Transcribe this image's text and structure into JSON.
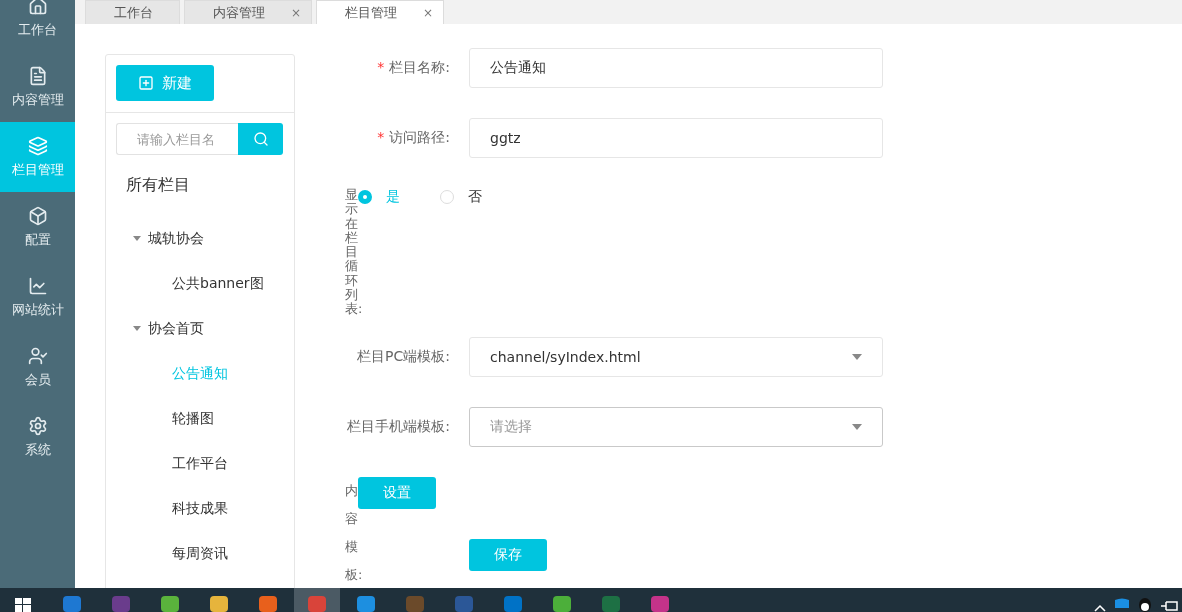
{
  "sidebar": {
    "items": [
      {
        "label": "工作台",
        "selected": false
      },
      {
        "label": "内容管理",
        "selected": false
      },
      {
        "label": "栏目管理",
        "selected": true
      },
      {
        "label": "配置",
        "selected": false
      },
      {
        "label": "网站统计",
        "selected": false
      },
      {
        "label": "会员",
        "selected": false
      },
      {
        "label": "系统",
        "selected": false
      }
    ]
  },
  "tabs": [
    {
      "label": "工作台",
      "selected": false
    },
    {
      "label": "内容管理",
      "close": "×",
      "selected": false
    },
    {
      "label": "栏目管理",
      "close": "×",
      "selected": true
    }
  ],
  "tree_panel": {
    "new_button": "新建",
    "search": {
      "placeholder": "请输入栏目名"
    },
    "root": "所有栏目",
    "nodes": [
      {
        "label": "城轨协会",
        "expanded": true,
        "selected": false,
        "children": [
          {
            "label": "公共banner图",
            "selected": false
          }
        ]
      },
      {
        "label": "协会首页",
        "expanded": true,
        "selected": false,
        "children": [
          {
            "label": "公告通知",
            "selected": true
          },
          {
            "label": "轮播图",
            "selected": false
          },
          {
            "label": "工作平台",
            "selected": false
          },
          {
            "label": "科技成果",
            "selected": false
          },
          {
            "label": "每周资讯",
            "selected": false
          }
        ]
      }
    ]
  },
  "form": {
    "fields": [
      {
        "kind": "text",
        "label": "栏目名称:",
        "required_mark": "*",
        "value": "公告通知"
      },
      {
        "kind": "text",
        "label": "访问路径:",
        "required_mark": "*",
        "value": "ggtz"
      },
      {
        "kind": "radio",
        "label": "显示在栏目循环列表:",
        "options": [
          {
            "label": "是",
            "selected": true
          },
          {
            "label": "否",
            "selected": false
          }
        ]
      },
      {
        "kind": "select",
        "label": "栏目PC端模板:",
        "value": "channel/syIndex.html"
      },
      {
        "kind": "select",
        "label": "栏目手机端模板:",
        "placeholder": "请选择"
      },
      {
        "kind": "button",
        "label": "内容模板:",
        "button": "设置"
      }
    ],
    "save_button": "保存"
  }
}
